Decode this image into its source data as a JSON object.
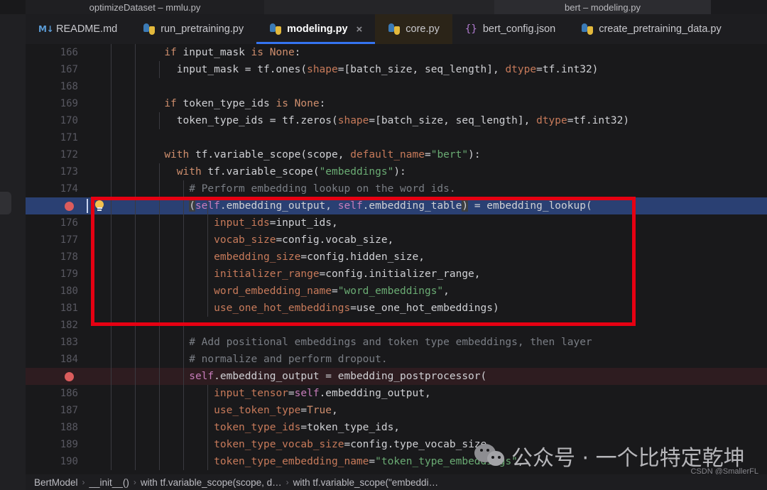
{
  "os_windows": [
    {
      "title": "optimizeDataset – mmlu.py"
    },
    {
      "title": ""
    },
    {
      "title": "bert – modeling.py"
    },
    {
      "title": ""
    }
  ],
  "tabs": [
    {
      "label": "README.md",
      "icon": "markdown-icon",
      "state": "normal"
    },
    {
      "label": "run_pretraining.py",
      "icon": "python-icon",
      "state": "normal"
    },
    {
      "label": "modeling.py",
      "icon": "python-icon",
      "state": "active",
      "close": "×"
    },
    {
      "label": "core.py",
      "icon": "python-icon",
      "state": "highlighted"
    },
    {
      "label": "bert_config.json",
      "icon": "json-icon",
      "state": "normal"
    },
    {
      "label": "create_pretraining_data.py",
      "icon": "python-icon",
      "state": "normal"
    }
  ],
  "editor": {
    "lines": [
      {
        "num": "166",
        "indents": 2,
        "state": "normal",
        "tokens": [
          {
            "t": "          ",
            "c": "punc"
          },
          {
            "t": "if",
            "c": "kw"
          },
          {
            "t": " input_mask ",
            "c": "punc"
          },
          {
            "t": "is",
            "c": "kw"
          },
          {
            "t": " ",
            "c": "punc"
          },
          {
            "t": "None",
            "c": "kw"
          },
          {
            "t": ":",
            "c": "punc"
          }
        ]
      },
      {
        "num": "167",
        "indents": 3,
        "state": "normal",
        "tokens": [
          {
            "t": "            input_mask = tf.ones(",
            "c": "punc"
          },
          {
            "t": "shape",
            "c": "arg"
          },
          {
            "t": "=[batch_size, seq_length], ",
            "c": "punc"
          },
          {
            "t": "dtype",
            "c": "arg"
          },
          {
            "t": "=tf.int32)",
            "c": "punc"
          }
        ]
      },
      {
        "num": "168",
        "indents": 2,
        "state": "normal",
        "tokens": []
      },
      {
        "num": "169",
        "indents": 2,
        "state": "normal",
        "tokens": [
          {
            "t": "          ",
            "c": "punc"
          },
          {
            "t": "if",
            "c": "kw"
          },
          {
            "t": " token_type_ids ",
            "c": "punc"
          },
          {
            "t": "is",
            "c": "kw"
          },
          {
            "t": " ",
            "c": "punc"
          },
          {
            "t": "None",
            "c": "kw"
          },
          {
            "t": ":",
            "c": "punc"
          }
        ]
      },
      {
        "num": "170",
        "indents": 3,
        "state": "normal",
        "tokens": [
          {
            "t": "            token_type_ids = tf.zeros(",
            "c": "punc"
          },
          {
            "t": "shape",
            "c": "arg"
          },
          {
            "t": "=[batch_size, seq_length], ",
            "c": "punc"
          },
          {
            "t": "dtype",
            "c": "arg"
          },
          {
            "t": "=tf.int32)",
            "c": "punc"
          }
        ]
      },
      {
        "num": "171",
        "indents": 2,
        "state": "normal",
        "tokens": []
      },
      {
        "num": "172",
        "indents": 2,
        "state": "normal",
        "tokens": [
          {
            "t": "          ",
            "c": "punc"
          },
          {
            "t": "with",
            "c": "kw"
          },
          {
            "t": " tf.variable_scope(scope, ",
            "c": "punc"
          },
          {
            "t": "default_name",
            "c": "arg"
          },
          {
            "t": "=",
            "c": "punc"
          },
          {
            "t": "\"bert\"",
            "c": "str"
          },
          {
            "t": "):",
            "c": "punc"
          }
        ]
      },
      {
        "num": "173",
        "indents": 3,
        "state": "normal",
        "tokens": [
          {
            "t": "            ",
            "c": "punc"
          },
          {
            "t": "with",
            "c": "kw"
          },
          {
            "t": " tf.variable_scope(",
            "c": "punc"
          },
          {
            "t": "\"embeddings\"",
            "c": "str"
          },
          {
            "t": "):",
            "c": "punc"
          }
        ]
      },
      {
        "num": "174",
        "indents": 4,
        "state": "normal",
        "tokens": [
          {
            "t": "              # Perform embedding lookup on the word ids.",
            "c": "cmt"
          }
        ]
      },
      {
        "num": "175",
        "indents": 5,
        "state": "selected",
        "breakpoint": true,
        "caret": true,
        "bulb": true,
        "tokens": [
          {
            "t": "              ",
            "c": "punc"
          },
          {
            "t": "(",
            "c": "mpar"
          },
          {
            "t": "self",
            "c": "self"
          },
          {
            "t": ".embedding_output, ",
            "c": "punc"
          },
          {
            "t": "self",
            "c": "self"
          },
          {
            "t": ".embedding_table",
            "c": "punc"
          },
          {
            "t": ")",
            "c": "mpar"
          },
          {
            "t": " = embedding_lookup(",
            "c": "punc"
          }
        ]
      },
      {
        "num": "176",
        "indents": 5,
        "state": "normal",
        "tokens": [
          {
            "t": "                  ",
            "c": "punc"
          },
          {
            "t": "input_ids",
            "c": "arg"
          },
          {
            "t": "=input_ids,",
            "c": "punc"
          }
        ]
      },
      {
        "num": "177",
        "indents": 5,
        "state": "normal",
        "tokens": [
          {
            "t": "                  ",
            "c": "punc"
          },
          {
            "t": "vocab_size",
            "c": "arg"
          },
          {
            "t": "=config.vocab_size,",
            "c": "punc"
          }
        ]
      },
      {
        "num": "178",
        "indents": 5,
        "state": "normal",
        "tokens": [
          {
            "t": "                  ",
            "c": "punc"
          },
          {
            "t": "embedding_size",
            "c": "arg"
          },
          {
            "t": "=config.hidden_size,",
            "c": "punc"
          }
        ]
      },
      {
        "num": "179",
        "indents": 5,
        "state": "normal",
        "tokens": [
          {
            "t": "                  ",
            "c": "punc"
          },
          {
            "t": "initializer_range",
            "c": "arg"
          },
          {
            "t": "=config.initializer_range,",
            "c": "punc"
          }
        ]
      },
      {
        "num": "180",
        "indents": 5,
        "state": "normal",
        "tokens": [
          {
            "t": "                  ",
            "c": "punc"
          },
          {
            "t": "word_embedding_name",
            "c": "arg"
          },
          {
            "t": "=",
            "c": "punc"
          },
          {
            "t": "\"word_embeddings\"",
            "c": "str"
          },
          {
            "t": ",",
            "c": "punc"
          }
        ]
      },
      {
        "num": "181",
        "indents": 5,
        "state": "normal",
        "tokens": [
          {
            "t": "                  ",
            "c": "punc"
          },
          {
            "t": "use_one_hot_embeddings",
            "c": "arg"
          },
          {
            "t": "=use_one_hot_embeddings)",
            "c": "punc"
          }
        ]
      },
      {
        "num": "182",
        "indents": 4,
        "state": "normal",
        "tokens": []
      },
      {
        "num": "183",
        "indents": 4,
        "state": "normal",
        "tokens": [
          {
            "t": "              # Add positional embeddings and token type embeddings, then layer",
            "c": "cmt"
          }
        ]
      },
      {
        "num": "184",
        "indents": 4,
        "state": "normal",
        "tokens": [
          {
            "t": "              # normalize and perform dropout.",
            "c": "cmt"
          }
        ]
      },
      {
        "num": "185",
        "indents": 4,
        "state": "breakpoint-line",
        "breakpoint": true,
        "tokens": [
          {
            "t": "              ",
            "c": "punc"
          },
          {
            "t": "self",
            "c": "self"
          },
          {
            "t": ".embedding_output = embedding_postprocessor(",
            "c": "punc"
          }
        ]
      },
      {
        "num": "186",
        "indents": 5,
        "state": "normal",
        "tokens": [
          {
            "t": "                  ",
            "c": "punc"
          },
          {
            "t": "input_tensor",
            "c": "arg"
          },
          {
            "t": "=",
            "c": "punc"
          },
          {
            "t": "self",
            "c": "self"
          },
          {
            "t": ".embedding_output,",
            "c": "punc"
          }
        ]
      },
      {
        "num": "187",
        "indents": 5,
        "state": "normal",
        "tokens": [
          {
            "t": "                  ",
            "c": "punc"
          },
          {
            "t": "use_token_type",
            "c": "arg"
          },
          {
            "t": "=",
            "c": "punc"
          },
          {
            "t": "True",
            "c": "kw"
          },
          {
            "t": ",",
            "c": "punc"
          }
        ]
      },
      {
        "num": "188",
        "indents": 5,
        "state": "normal",
        "tokens": [
          {
            "t": "                  ",
            "c": "punc"
          },
          {
            "t": "token_type_ids",
            "c": "arg"
          },
          {
            "t": "=token_type_ids,",
            "c": "punc"
          }
        ]
      },
      {
        "num": "189",
        "indents": 5,
        "state": "normal",
        "tokens": [
          {
            "t": "                  ",
            "c": "punc"
          },
          {
            "t": "token_type_vocab_size",
            "c": "arg"
          },
          {
            "t": "=config.type_vocab_size,",
            "c": "punc"
          }
        ]
      },
      {
        "num": "190",
        "indents": 5,
        "state": "normal",
        "tokens": [
          {
            "t": "                  ",
            "c": "punc"
          },
          {
            "t": "token_type_embedding_name",
            "c": "arg"
          },
          {
            "t": "=",
            "c": "punc"
          },
          {
            "t": "\"token_type_embeddings\"",
            "c": "str"
          },
          {
            "t": ",",
            "c": "punc"
          }
        ]
      }
    ]
  },
  "annotation": {
    "box_color": "#e60012",
    "label": "red-highlight-box"
  },
  "breadcrumb": {
    "items": [
      "BertModel",
      "__init__()",
      "with tf.variable_scope(scope, d…",
      "with tf.variable_scope(\"embeddi…"
    ],
    "separator": "›"
  },
  "watermark": {
    "text": "公众号 · 一个比特定乾坤",
    "credit": "CSDN @SmallerFL"
  },
  "colors": {
    "background": "#19191b",
    "selection": "#2a4073",
    "breakpoint": "#db5c5c",
    "accent": "#3574f0"
  }
}
